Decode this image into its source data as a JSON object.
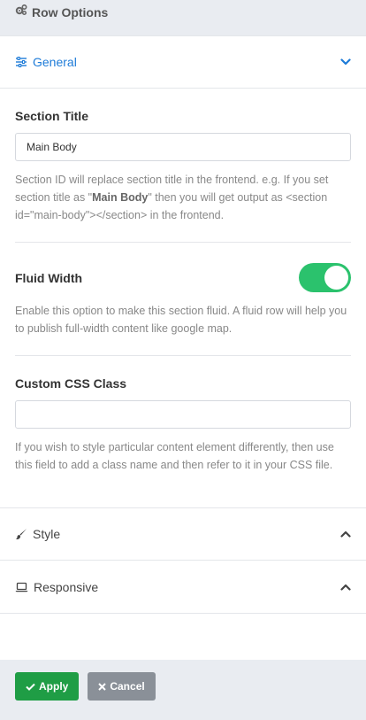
{
  "header": {
    "title": "Row Options",
    "icon": "gears-icon"
  },
  "general": {
    "label": "General",
    "icon": "sliders-icon",
    "expanded": true,
    "accent": "#1d7bd8",
    "section_title": {
      "label": "Section Title",
      "value": "Main Body",
      "help_pre": "Section ID will replace section title in the frontend. e.g. If you set section title as \"",
      "help_bold": "Main Body",
      "help_post": "\" then you will get output as <section id=\"main-body\"></section> in the frontend."
    },
    "fluid_width": {
      "label": "Fluid Width",
      "enabled": true,
      "toggle_color": "#2bc26d",
      "help": "Enable this option to make this section fluid. A fluid row will help you to publish full-width content like google map."
    },
    "custom_css_class": {
      "label": "Custom CSS Class",
      "value": "",
      "help": "If you wish to style particular content element differently, then use this field to add a class name and then refer to it in your CSS file."
    }
  },
  "style": {
    "label": "Style",
    "icon": "paintbrush-icon"
  },
  "responsive": {
    "label": "Responsive",
    "icon": "laptop-icon"
  },
  "footer": {
    "apply_label": "Apply",
    "cancel_label": "Cancel",
    "apply_color": "#1f9d45",
    "cancel_color": "#8a9098"
  }
}
